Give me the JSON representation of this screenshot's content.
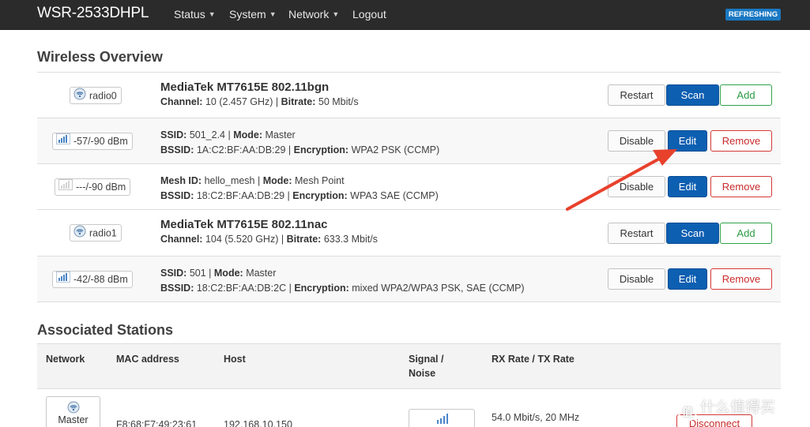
{
  "header": {
    "brand": "WSR-2533DHPL",
    "nav": [
      "Status",
      "System",
      "Network",
      "Logout"
    ],
    "badge": "REFRESHING"
  },
  "wireless": {
    "title": "Wireless Overview",
    "radios": [
      {
        "chip": "radio0",
        "name": "MediaTek MT7615E 802.11bgn",
        "channel_label": "Channel:",
        "channel": "10 (2.457 GHz)",
        "bitrate_label": "Bitrate:",
        "bitrate": "50 Mbit/s",
        "buttons": [
          "Restart",
          "Scan",
          "Add"
        ]
      },
      {
        "chip": "radio1",
        "name": "MediaTek MT7615E 802.11nac",
        "channel_label": "Channel:",
        "channel": "104 (5.520 GHz)",
        "bitrate_label": "Bitrate:",
        "bitrate": "633.3 Mbit/s",
        "buttons": [
          "Restart",
          "Scan",
          "Add"
        ]
      }
    ],
    "networks": [
      {
        "chip": "-57/-90 dBm",
        "line1_label": "SSID:",
        "line1_value": "501_2.4",
        "mode_label": "Mode:",
        "mode": "Master",
        "bssid_label": "BSSID:",
        "bssid": "1A:C2:BF:AA:DB:29",
        "enc_label": "Encryption:",
        "encryption": "WPA2 PSK (CCMP)",
        "buttons": [
          "Disable",
          "Edit",
          "Remove"
        ]
      },
      {
        "chip": "---/-90 dBm",
        "line1_label": "Mesh ID:",
        "line1_value": "hello_mesh",
        "mode_label": "Mode:",
        "mode": "Mesh Point",
        "bssid_label": "BSSID:",
        "bssid": "18:C2:BF:AA:DB:29",
        "enc_label": "Encryption:",
        "encryption": "WPA3 SAE (CCMP)",
        "buttons": [
          "Disable",
          "Edit",
          "Remove"
        ]
      },
      {
        "chip": "-42/-88 dBm",
        "line1_label": "SSID:",
        "line1_value": "501",
        "mode_label": "Mode:",
        "mode": "Master",
        "bssid_label": "BSSID:",
        "bssid": "18:C2:BF:AA:DB:2C",
        "enc_label": "Encryption:",
        "encryption": "mixed WPA2/WPA3 PSK, SAE (CCMP)",
        "buttons": [
          "Disable",
          "Edit",
          "Remove"
        ]
      }
    ]
  },
  "stations": {
    "title": "Associated Stations",
    "columns": [
      "Network",
      "MAC address",
      "Host",
      "Signal / Noise",
      "RX Rate / TX Rate"
    ],
    "row": {
      "network": "Master",
      "mac": "F8:68:F7:49:23:61",
      "host": "192.168.10.150",
      "rate": "54.0 Mbit/s, 20 MHz",
      "action": "Disconnect"
    }
  },
  "watermark": {
    "logo": "值",
    "text": "什么值得买"
  },
  "colors": {
    "topbar": "#2b2b2b",
    "primary": "#0d5fb1",
    "positive": "#2da24b",
    "negative": "#d43838",
    "annotation_arrow": "#e8412c"
  }
}
